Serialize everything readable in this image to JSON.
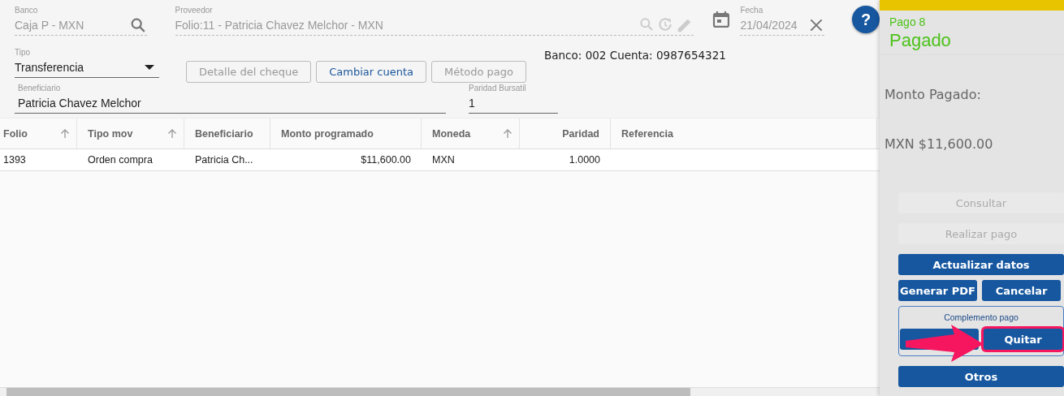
{
  "form": {
    "banco": {
      "label": "Banco",
      "value": "Caja P - MXN",
      "disabled": true
    },
    "proveedor": {
      "label": "Proveedor",
      "value": "Folio:11 - Patricia Chavez Melchor - MXN",
      "disabled": true
    },
    "fecha": {
      "label": "Fecha",
      "value": "21/04/2024",
      "disabled": true
    },
    "help": "?",
    "tipo": {
      "label": "Tipo",
      "value": "Transferencia"
    },
    "buttons": [
      {
        "label": "Detalle del cheque",
        "disabled": true
      },
      {
        "label": "Cambiar cuenta",
        "disabled": false
      },
      {
        "label": "Método pago",
        "disabled": true
      }
    ],
    "account_info": "Banco: 002 Cuenta: 0987654321",
    "beneficiario": {
      "label": "Beneficiario",
      "value": "Patricia Chavez Melchor"
    },
    "paridad": {
      "label": "Paridad Bursatil",
      "value": "1"
    }
  },
  "table": {
    "columns": [
      {
        "label": "Folio",
        "sortable": true
      },
      {
        "label": "Tipo mov",
        "sortable": true
      },
      {
        "label": "Beneficiario",
        "sortable": false
      },
      {
        "label": "Monto programado",
        "sortable": false
      },
      {
        "label": "Moneda",
        "sortable": true
      },
      {
        "label": "Paridad",
        "sortable": false
      },
      {
        "label": "Referencia",
        "sortable": false
      }
    ],
    "rows": [
      [
        "1393",
        "Orden compra",
        "Patricia Ch...",
        "$11,600.00",
        "MXN",
        "1.0000",
        ""
      ]
    ]
  },
  "panel": {
    "subtitle": "Pago 8",
    "status": "Pagado",
    "amount_label": "Monto Pagado:",
    "amount": "MXN $11,600.00",
    "actions": [
      {
        "label": "Consultar",
        "disabled": true
      },
      {
        "label": "Realizar pago",
        "disabled": true
      },
      {
        "label": "Actualizar datos",
        "disabled": false
      }
    ],
    "pair": [
      {
        "label": "Generar PDF",
        "disabled": false
      },
      {
        "label": "Cancelar",
        "disabled": false
      }
    ],
    "complemento": {
      "title": "Complemento pago",
      "buttons": [
        {
          "highlighted": false
        },
        {
          "label": "Quitar",
          "highlighted": true
        }
      ]
    },
    "other": {
      "label": "Otros",
      "disabled": false
    }
  }
}
